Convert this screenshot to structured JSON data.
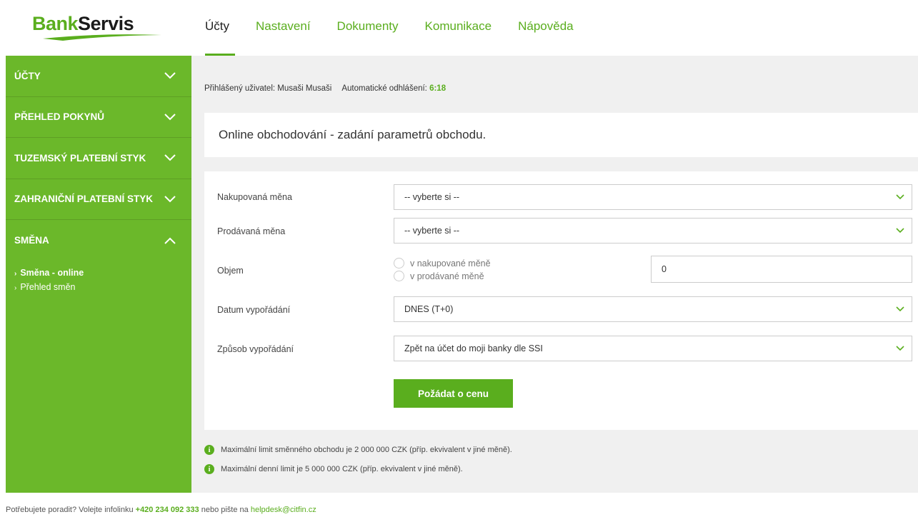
{
  "brand": {
    "part1": "Bank",
    "part2": "Servis",
    "color": "#5aae1e"
  },
  "nav": [
    {
      "label": "Účty",
      "active": true
    },
    {
      "label": "Nastavení"
    },
    {
      "label": "Dokumenty"
    },
    {
      "label": "Komunikace"
    },
    {
      "label": "Nápověda"
    }
  ],
  "sidebar": {
    "items": [
      {
        "label": "ÚČTY",
        "icon": "chevron-down-icon"
      },
      {
        "label": "PŘEHLED POKYNŮ",
        "icon": "chevron-down-icon"
      },
      {
        "label": "TUZEMSKÝ PLATEBNÍ STYK",
        "icon": "chevron-down-icon"
      },
      {
        "label": "ZAHRANIČNÍ PLATEBNÍ STYK",
        "icon": "chevron-down-icon"
      },
      {
        "label": "SMĚNA",
        "icon": "chevron-up-icon",
        "expanded": true
      }
    ],
    "sub_items": [
      {
        "label": "Směna - online",
        "active": true
      },
      {
        "label": "Přehled směn"
      }
    ]
  },
  "userbar": {
    "user_label": "Přihlášený uživatel: Musaši Musaši",
    "logout_label": "Automatické odhlášení:",
    "logout_timer": "6:18"
  },
  "page_title": "Online obchodování - zadání parametrů obchodu.",
  "form": {
    "buy_currency": {
      "label": "Nakupovaná měna",
      "value": "-- vyberte si --"
    },
    "sell_currency": {
      "label": "Prodávaná měna",
      "value": "-- vyberte si --"
    },
    "volume": {
      "label": "Objem",
      "option1": "v nakupované měně",
      "option2": "v prodávané měně",
      "amount": "0"
    },
    "settlement_date": {
      "label": "Datum vypořádání",
      "value": "DNES (T+0)"
    },
    "settlement_method": {
      "label": "Způsob vypořádání",
      "value": "Zpět na účet do moji banky dle SSI"
    },
    "submit_label": "Požádat o cenu"
  },
  "notes": [
    "Maximální limit směnného obchodu je 2 000 000 CZK (příp. ekvivalent v jiné měně).",
    "Maximální denní limit je 5 000 000 CZK (příp. ekvivalent v jiné měně)."
  ],
  "footer": {
    "prefix": "Potřebujete poradit? Volejte infolinku",
    "phone": "+420 234 092 333",
    "middle": "nebo pište na",
    "email": "helpdesk@citfin.cz"
  }
}
